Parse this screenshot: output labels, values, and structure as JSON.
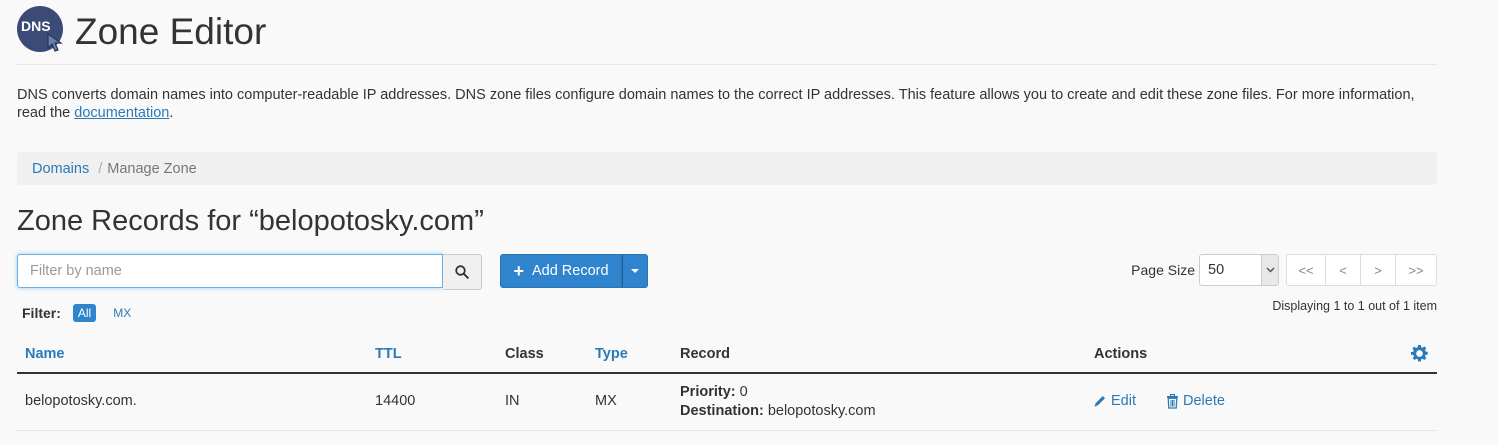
{
  "header": {
    "logo_text": "DNS",
    "title": "Zone Editor"
  },
  "description": {
    "text": "DNS converts domain names into computer-readable IP addresses. DNS zone files configure domain names to the correct IP addresses. This feature allows you to create and edit these zone files. For more information, read the ",
    "link_text": "documentation",
    "suffix": "."
  },
  "breadcrumb": {
    "items": [
      {
        "label": "Domains"
      },
      {
        "label": "Manage Zone"
      }
    ],
    "separator": "/"
  },
  "section_title": "Zone Records for “belopotosky.com”",
  "search": {
    "placeholder": "Filter by name",
    "value": ""
  },
  "add_record": {
    "label": "Add Record"
  },
  "pagination": {
    "page_size_label": "Page Size",
    "page_size_value": "50",
    "first": "<<",
    "prev": "<",
    "next": ">",
    "last": ">>",
    "display_info": "Displaying 1 to 1 out of 1 item"
  },
  "filter": {
    "label": "Filter:",
    "options": [
      "All",
      "MX"
    ],
    "active": "All"
  },
  "table": {
    "columns": [
      "Name",
      "TTL",
      "Class",
      "Type",
      "Record",
      "Actions"
    ],
    "rows": [
      {
        "name": "belopotosky.com.",
        "ttl": "14400",
        "class": "IN",
        "type": "MX",
        "priority_label": "Priority:",
        "priority": "0",
        "destination_label": "Destination:",
        "destination": "belopotosky.com",
        "edit_label": "Edit",
        "delete_label": "Delete"
      }
    ]
  },
  "colors": {
    "accent": "#2f84cd",
    "link": "#2a7ab8",
    "logo_bg": "#3b4a76"
  }
}
